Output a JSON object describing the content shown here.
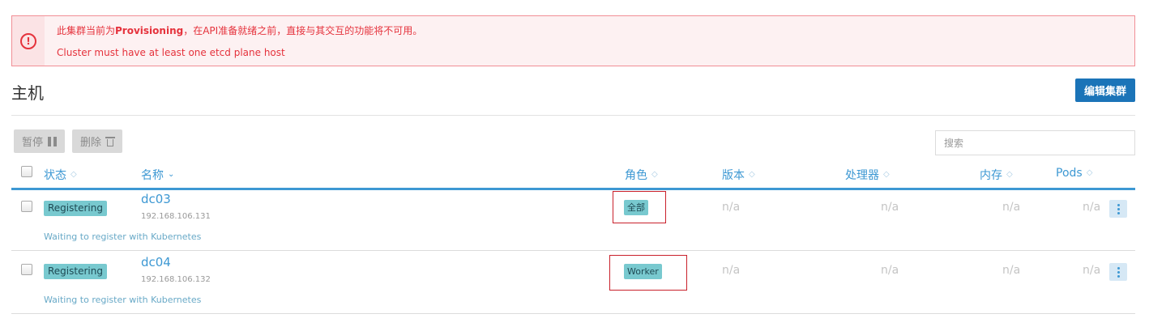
{
  "alert": {
    "line1_prefix": "此集群当前为",
    "line1_state": "Provisioning",
    "line1_suffix": "，在API准备就绪之前，直接与其交互的功能将不可用。",
    "line2": "Cluster must have at least one etcd plane host",
    "icon": "alert-circle-icon",
    "color": "#e5323c"
  },
  "header": {
    "title": "主机",
    "edit_button": "编辑集群"
  },
  "toolbar": {
    "pause_label": "暂停",
    "delete_label": "删除",
    "search_placeholder": "搜索"
  },
  "table": {
    "columns": {
      "state": "状态",
      "name": "名称",
      "roles": "角色",
      "version": "版本",
      "cpu": "处理器",
      "memory": "内存",
      "pods": "Pods"
    },
    "rows": [
      {
        "state": "Registering",
        "name": "dc03",
        "ip": "192.168.106.131",
        "role": "全部",
        "version": "n/a",
        "cpu": "n/a",
        "memory": "n/a",
        "pods": "n/a",
        "message": "Waiting to register with Kubernetes"
      },
      {
        "state": "Registering",
        "name": "dc04",
        "ip": "192.168.106.132",
        "role": "Worker",
        "version": "n/a",
        "cpu": "n/a",
        "memory": "n/a",
        "pods": "n/a",
        "message": "Waiting to register with Kubernetes"
      }
    ]
  },
  "colors": {
    "accent": "#3d98d3",
    "primary_button": "#1b74b8",
    "badge": "#78c9cf",
    "highlight_box": "#c9202b"
  }
}
